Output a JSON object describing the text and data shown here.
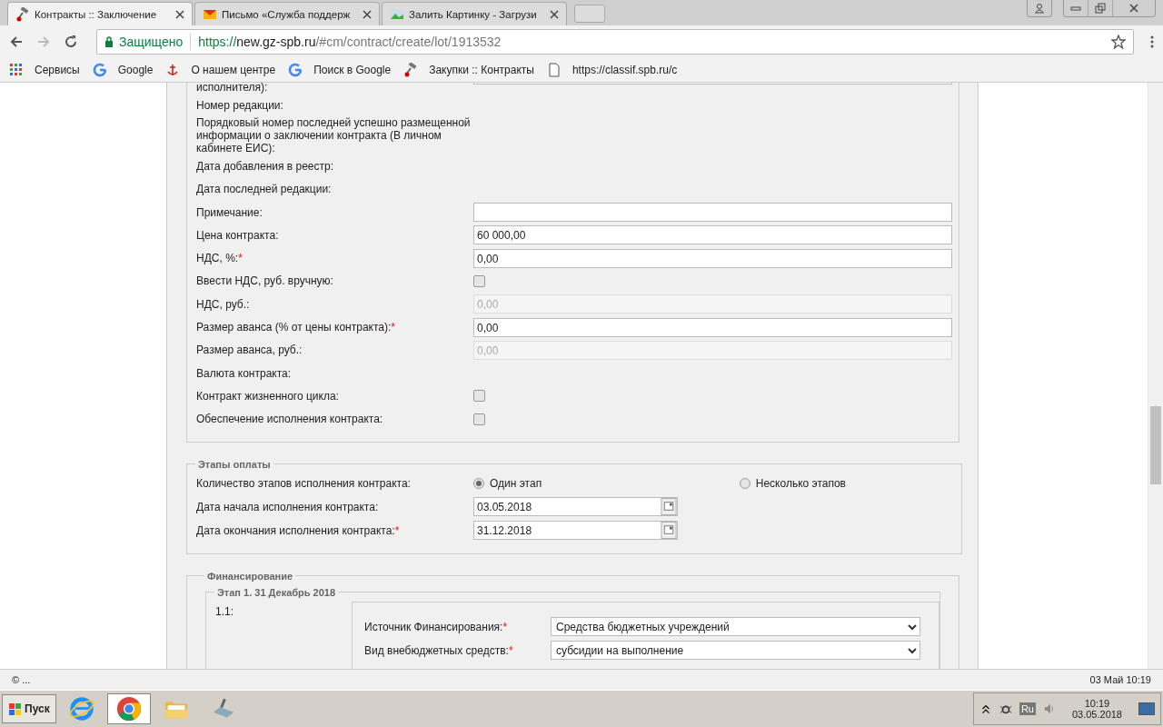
{
  "tabs": [
    {
      "title": "Контракты :: Заключение",
      "selected": true
    },
    {
      "title": "Письмо «Служба поддерж",
      "selected": false
    },
    {
      "title": "Залить Картинку - Загрузи",
      "selected": false
    }
  ],
  "address": {
    "secure_label": "Защищено",
    "scheme": "https://",
    "host": "new.gz-spb.ru",
    "path": "/#cm/contract/create/lot/1913532"
  },
  "bookmarks": [
    "Сервисы",
    "Google",
    "О нашем центре",
    "Поиск в Google",
    "Закупки :: Контракты",
    "https://classif.spb.ru/c"
  ],
  "form": {
    "rows": [
      {
        "label": "исполнителя):",
        "kind": "cut"
      },
      {
        "label": "Номер редакции:",
        "kind": "text"
      },
      {
        "label": "Порядковый номер последней успешно размещенной информации о заключении контракта (В личном кабинете ЕИС):",
        "kind": "text"
      },
      {
        "label": "Дата добавления в реестр:",
        "kind": "text"
      },
      {
        "label": "Дата последней редакции:",
        "kind": "text"
      },
      {
        "label": "Примечание:",
        "kind": "input",
        "disabled": false
      },
      {
        "label": "Цена контракта:",
        "kind": "input",
        "disabled": false,
        "value": "60 000,00"
      },
      {
        "label": "НДС, %:",
        "required_mark": "*",
        "kind": "input",
        "disabled": false,
        "value": "0,00"
      },
      {
        "label": "Ввести НДС, руб. вручную:",
        "kind": "checkbox",
        "checked": false
      },
      {
        "label": "НДС, руб.:",
        "kind": "input",
        "disabled": true,
        "value": "0,00"
      },
      {
        "label": "Размер аванса (% от цены контракта):",
        "required_mark": "*",
        "kind": "input",
        "disabled": false,
        "value": "0,00"
      },
      {
        "label": "Размер аванса, руб.:",
        "kind": "input",
        "disabled": true,
        "value": "0,00"
      },
      {
        "label": "Валюта контракта:",
        "kind": "text"
      },
      {
        "label": "Контракт жизненного цикла:",
        "kind": "checkbox",
        "checked": false
      },
      {
        "label": "Обеспечение исполнения контракта:",
        "kind": "checkbox",
        "checked": false
      }
    ]
  },
  "payment": {
    "legend": "Этапы оплаты",
    "count_label": "Количество этапов исполнения контракта:",
    "options": [
      {
        "label": "Один этап",
        "selected": true
      },
      {
        "label": "Несколько этапов",
        "selected": false
      }
    ],
    "dates": [
      {
        "label": "Дата начала исполнения контракта:",
        "value": "03.05.2018"
      },
      {
        "label": "Дата окончания исполнения контракта:",
        "required_mark": "*",
        "value": "31.12.2018"
      }
    ]
  },
  "financing": {
    "legend": "Финансирование",
    "stage_legend": "Этап 1. 31 Декабрь 2018",
    "item_number": "1.1:",
    "selects": [
      {
        "label": "Источник Финансирования:",
        "required_mark": "*",
        "value": "Средства бюджетных учреждений"
      },
      {
        "label": "Вид внебюджетных средств:",
        "required_mark": "*",
        "value": "субсидии на выполнение"
      }
    ]
  },
  "status_bar": {
    "left": "© ...",
    "right": "03 Май 10:19"
  },
  "taskbar": {
    "start": "Пуск",
    "apps": [
      {
        "selected": false
      },
      {
        "selected": true
      },
      {
        "selected": false
      },
      {
        "selected": false
      }
    ],
    "language": "Ru",
    "time": "10:19",
    "date": "03.05.2018"
  }
}
